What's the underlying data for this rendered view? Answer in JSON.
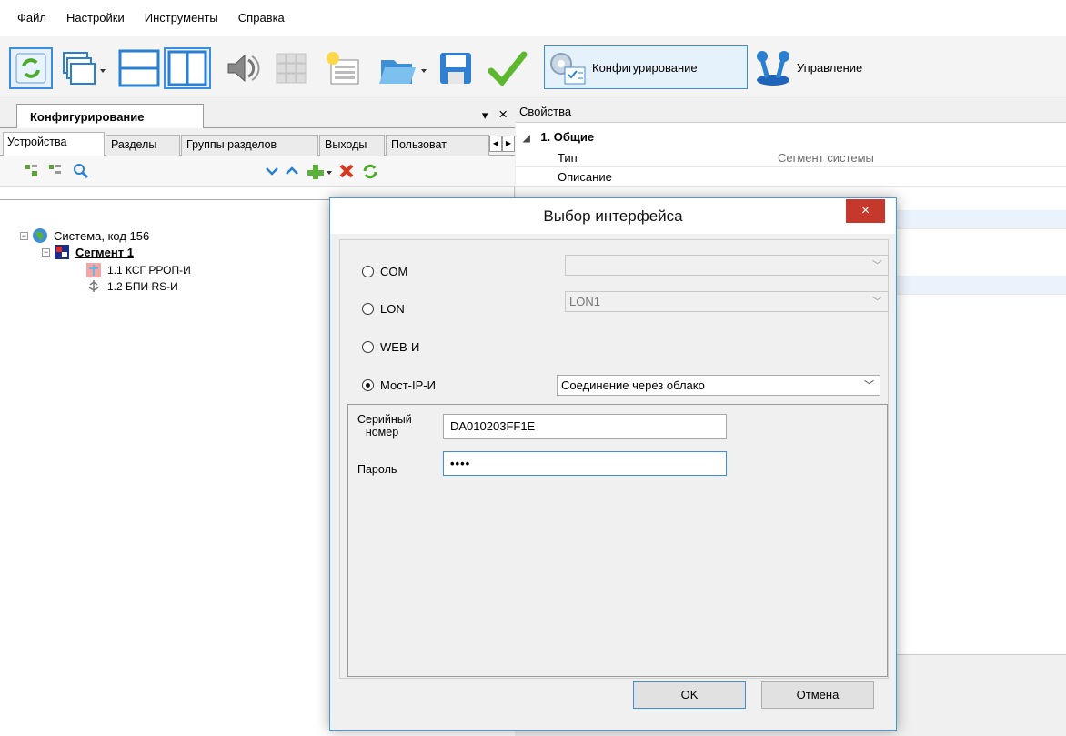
{
  "menu": [
    "Файл",
    "Настройки",
    "Инструменты",
    "Справка"
  ],
  "toolbar": {
    "config_label": "Конфигурирование",
    "manage_label": "Управление"
  },
  "left_panel": {
    "tab_label": "Конфигурирование",
    "pin_label": "▾",
    "close_label": "×",
    "subtabs": [
      "Устройства",
      "Разделы",
      "Группы разделов",
      "Выходы",
      "Пользоват"
    ],
    "tree": [
      {
        "label": "Система, код 156"
      },
      {
        "label": "Сегмент 1"
      },
      {
        "label": "1.1 КСГ РРОП-И"
      },
      {
        "label": "1.2 БПИ RS-И"
      }
    ]
  },
  "properties": {
    "header": "Свойства",
    "section": "1. Общие",
    "rows": [
      {
        "key": "Тип",
        "value": "Сегмент системы"
      },
      {
        "key": "Описание",
        "value": ""
      }
    ]
  },
  "dialog": {
    "title": "Выбор интерфейса",
    "close": "×",
    "options": [
      {
        "label": "COM",
        "combo": "",
        "checked": false
      },
      {
        "label": "LON",
        "combo": "LON1",
        "checked": false
      },
      {
        "label": "WEB-И",
        "checked": false
      },
      {
        "label": "Мост-IP-И",
        "combo": "Соединение через облако",
        "checked": true
      }
    ],
    "serial_label_1": "Серийный",
    "serial_label_2": "номер",
    "serial_value": "DA010203FF1E",
    "password_label": "Пароль",
    "password_value": "••••",
    "ok": "OK",
    "cancel": "Отмена"
  }
}
